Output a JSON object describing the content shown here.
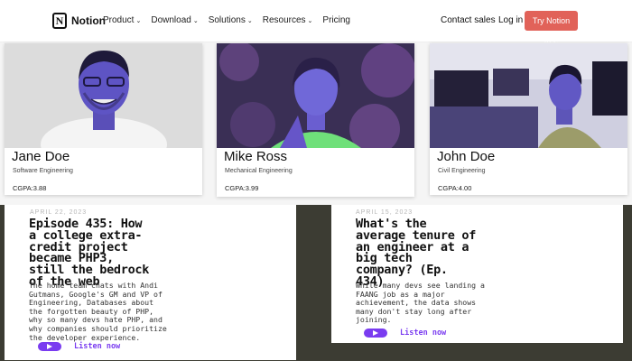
{
  "nav": {
    "brand": "Notion",
    "logo_letter": "N",
    "menu": [
      {
        "label": "Product",
        "dropdown": true
      },
      {
        "label": "Download",
        "dropdown": true
      },
      {
        "label": "Solutions",
        "dropdown": true
      },
      {
        "label": "Resources",
        "dropdown": true
      },
      {
        "label": "Pricing",
        "dropdown": false
      }
    ],
    "contact": "Contact sales",
    "login": "Log in",
    "cta": "Try Notion free",
    "cta_color": "#e16259"
  },
  "profiles": [
    {
      "name": "Jane Doe",
      "dept": "Software Engineering",
      "cgpa": "CGPA:3.88"
    },
    {
      "name": "Mike Ross",
      "dept": "Mechanical Engineering",
      "cgpa": "CGPA:3.99"
    },
    {
      "name": "John Doe",
      "dept": "Civil Engineering",
      "cgpa": "CGPA:4.00"
    }
  ],
  "episodes": [
    {
      "date": "APRIL 22, 2023",
      "title_lines": [
        "Episode 435: How",
        "a college extra-",
        "credit project",
        "became PHP3,",
        "still the bedrock",
        "of the web"
      ],
      "desc_lines": [
        "The home team chats with Andi",
        "Gutmans, Google's GM and VP of",
        "Engineering, Databases about",
        "the forgotten beauty of PHP,",
        "why so many devs hate PHP, and",
        "why companies should prioritize",
        "the developer experience."
      ],
      "listen": "Listen now"
    },
    {
      "date": "APRIL 15, 2023",
      "title_lines": [
        "What's the",
        "average tenure of",
        "an engineer at a",
        "big tech",
        "company? (Ep.",
        "434)"
      ],
      "desc_lines": [
        "While many devs see landing a",
        "FAANG job as a major",
        "achievement, the data shows",
        "many don't stay long after",
        "joining."
      ],
      "listen": "Listen now"
    }
  ],
  "accent": "#7a3cf0"
}
